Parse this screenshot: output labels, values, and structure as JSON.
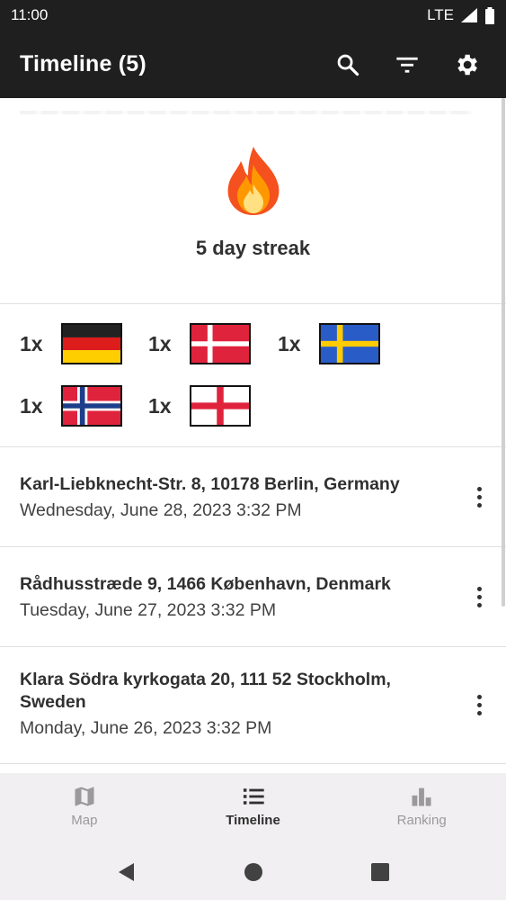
{
  "status_bar": {
    "time": "11:00",
    "network": "LTE"
  },
  "app_bar": {
    "title": "Timeline (5)",
    "actions": [
      "search-icon",
      "filter-icon",
      "settings-icon"
    ]
  },
  "streak": {
    "icon": "fire-icon",
    "text": "5 day streak"
  },
  "flags": [
    {
      "count": "1x",
      "country": "Germany",
      "icon": "flag-germany-icon"
    },
    {
      "count": "1x",
      "country": "Denmark",
      "icon": "flag-denmark-icon"
    },
    {
      "count": "1x",
      "country": "Sweden",
      "icon": "flag-sweden-icon"
    },
    {
      "count": "1x",
      "country": "Norway",
      "icon": "flag-norway-icon"
    },
    {
      "count": "1x",
      "country": "England",
      "icon": "flag-england-icon"
    }
  ],
  "timeline": [
    {
      "address": "Karl-Liebknecht-Str. 8, 10178 Berlin, Germany",
      "date": "Wednesday, June 28, 2023 3:32 PM"
    },
    {
      "address": "Rådhusstræde 9, 1466 København, Denmark",
      "date": "Tuesday, June 27, 2023 3:32 PM"
    },
    {
      "address": "Klara Södra kyrkogata 20, 111 52 Stockholm, Sweden",
      "date": "Monday, June 26, 2023 3:32 PM"
    }
  ],
  "bottom_nav": [
    {
      "label": "Map",
      "icon": "map-icon",
      "active": false
    },
    {
      "label": "Timeline",
      "icon": "list-icon",
      "active": true
    },
    {
      "label": "Ranking",
      "icon": "bar-chart-icon",
      "active": false
    }
  ],
  "colors": {
    "app_bar": "#1f1f1f",
    "nav_bg": "#f1eff1",
    "text": "#303030"
  }
}
